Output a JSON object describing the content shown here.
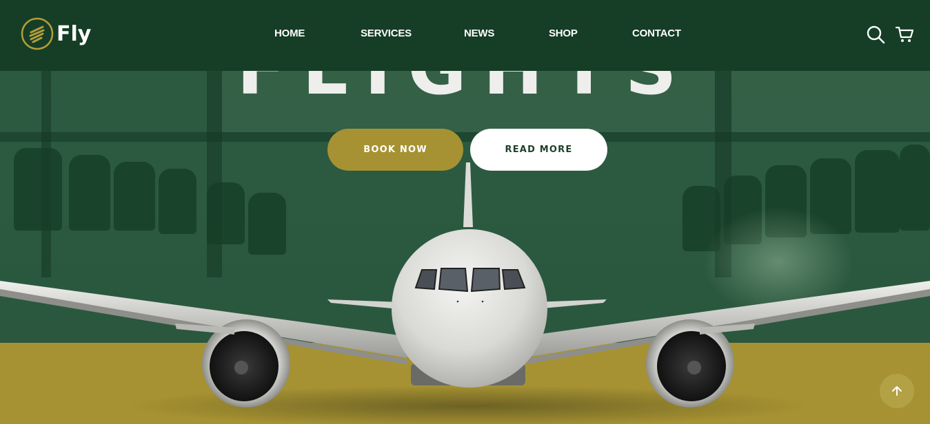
{
  "brand": {
    "name": "Fly"
  },
  "nav": {
    "items": [
      {
        "label": "HOME"
      },
      {
        "label": "SERVICES"
      },
      {
        "label": "NEWS"
      },
      {
        "label": "SHOP"
      },
      {
        "label": "CONTACT"
      }
    ]
  },
  "header_icons": {
    "search": "search-icon",
    "cart": "cart-icon"
  },
  "hero": {
    "headline": "FLIGHTS",
    "buttons": {
      "book_now": "BOOK NOW",
      "read_more": "READ MORE"
    }
  },
  "back_to_top": {
    "icon": "arrow-up-icon"
  },
  "colors": {
    "header_bg": "#163d26",
    "hero_green": "#2b5a40",
    "accent_gold": "#a69232",
    "button_light": "#ffffff",
    "text_dark": "#1f3f2c"
  }
}
